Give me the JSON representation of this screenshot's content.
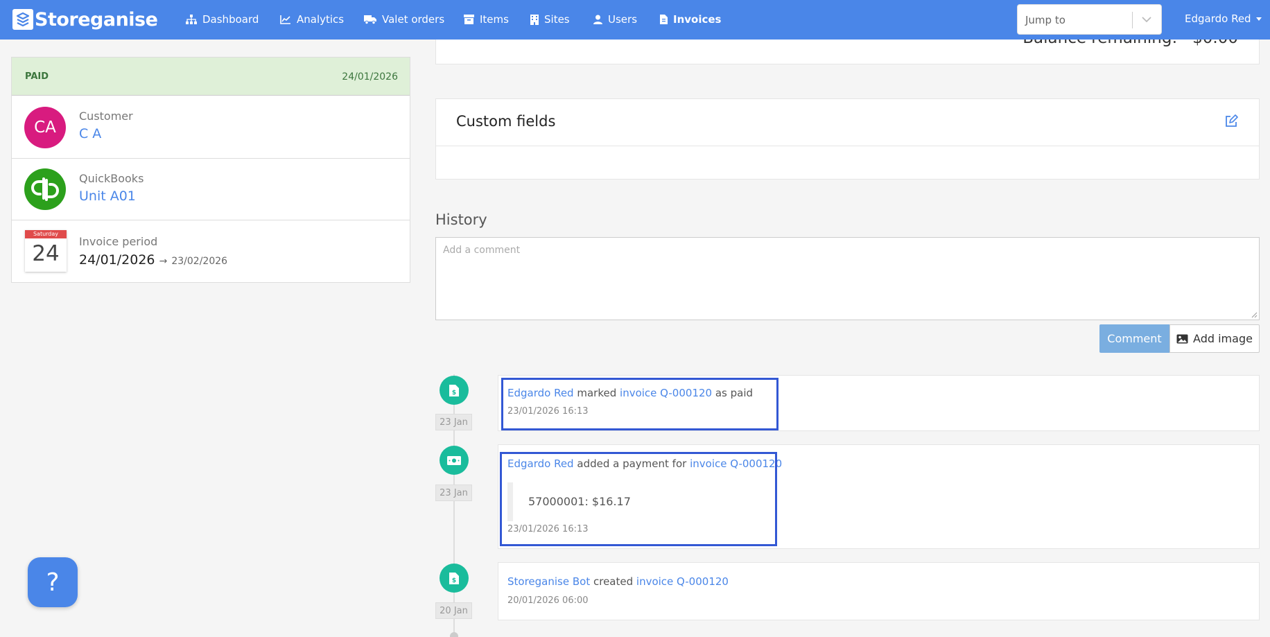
{
  "brand": {
    "name": "Storeganise"
  },
  "nav": {
    "items": [
      {
        "label": "Dashboard",
        "icon": "sitemap-icon"
      },
      {
        "label": "Analytics",
        "icon": "line-chart-icon"
      },
      {
        "label": "Valet orders",
        "icon": "truck-icon"
      },
      {
        "label": "Items",
        "icon": "archive-icon"
      },
      {
        "label": "Sites",
        "icon": "building-icon"
      },
      {
        "label": "Users",
        "icon": "user-icon"
      },
      {
        "label": "Invoices",
        "icon": "file-invoice-icon",
        "active": true
      }
    ],
    "jump_placeholder": "Jump to",
    "user_name": "Edgardo Red"
  },
  "invoice": {
    "status": "PAID",
    "status_date": "24/01/2026",
    "customer_label": "Customer",
    "customer_initials": "CA",
    "customer_name": "C A",
    "quickbooks_label": "QuickBooks",
    "quickbooks_value": "Unit A01",
    "period_label": "Invoice period",
    "calendar_day_name": "Saturday",
    "calendar_day_num": "24",
    "period_start": "24/01/2026",
    "period_arrow": "→",
    "period_end": "23/02/2026"
  },
  "balance": {
    "label": "Balance remaining:",
    "value": "$0.00"
  },
  "custom_fields": {
    "title": "Custom fields"
  },
  "history": {
    "title": "History",
    "comment_placeholder": "Add a comment",
    "comment_button": "Comment",
    "add_image_button": "Add image",
    "entries": [
      {
        "date_badge": "23 Jan",
        "actor": "Edgardo Red",
        "action": "marked",
        "object": "invoice Q-000120",
        "suffix": "as paid",
        "timestamp": "23/01/2026 16:13"
      },
      {
        "date_badge": "23 Jan",
        "actor": "Edgardo Red",
        "action": "added a payment for",
        "object": "invoice Q-000120",
        "detail": "57000001: $16.17",
        "timestamp": "23/01/2026 16:13"
      },
      {
        "date_badge": "20 Jan",
        "actor": "Storeganise Bot",
        "action": "created",
        "object": "invoice Q-000120",
        "timestamp": "20/01/2026 06:00"
      }
    ]
  },
  "help": {
    "label": "?"
  },
  "colors": {
    "primary": "#4a86e8",
    "paid_bg": "#dff0d8",
    "paid_text": "#3c763d",
    "timeline_icon": "#1abc9c",
    "highlight": "#3358d4"
  }
}
